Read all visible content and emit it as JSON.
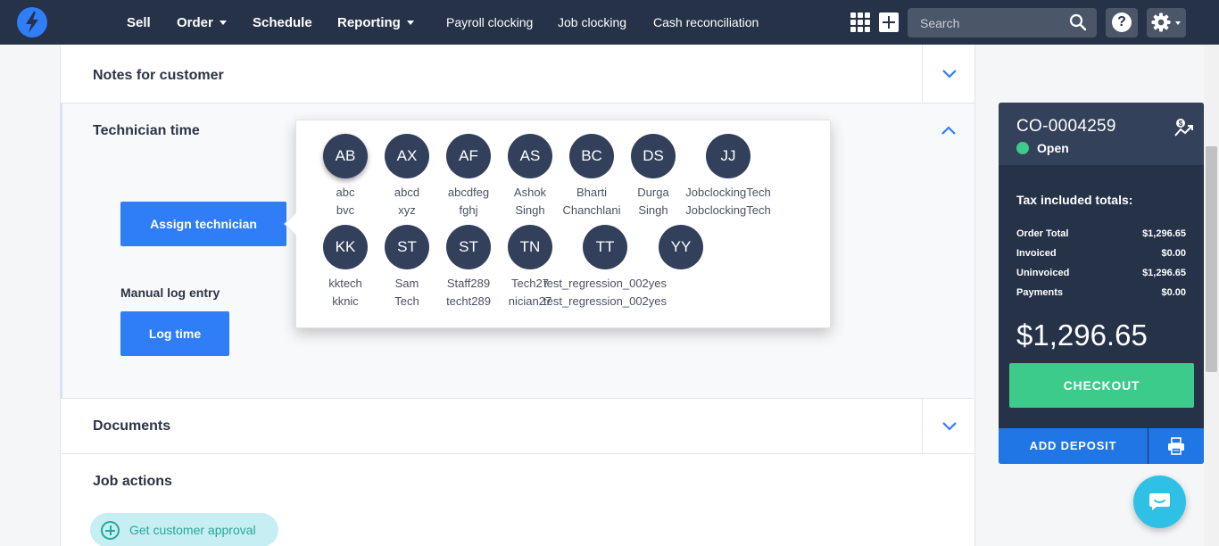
{
  "nav": {
    "items": [
      {
        "label": "Sell",
        "dropdown": false
      },
      {
        "label": "Order",
        "dropdown": true
      },
      {
        "label": "Schedule",
        "dropdown": false
      },
      {
        "label": "Reporting",
        "dropdown": true
      },
      {
        "label": "Payroll clocking"
      },
      {
        "label": "Job clocking"
      },
      {
        "label": "Cash reconciliation"
      }
    ],
    "search_placeholder": "Search",
    "help_label": "?"
  },
  "sections": {
    "notes_title": "Notes for customer",
    "tech_title": "Technician time",
    "assign_label": "Assign technician",
    "manual_label": "Manual log entry",
    "log_label": "Log time",
    "documents_title": "Documents",
    "job_actions_title": "Job actions",
    "approval_label": "Get customer approval"
  },
  "technicians": [
    {
      "initials": "AB",
      "line1": "abc",
      "line2": "bvc"
    },
    {
      "initials": "AX",
      "line1": "abcd",
      "line2": "xyz"
    },
    {
      "initials": "AF",
      "line1": "abcdfeg",
      "line2": "fghj"
    },
    {
      "initials": "AS",
      "line1": "Ashok",
      "line2": "Singh"
    },
    {
      "initials": "BC",
      "line1": "Bharti",
      "line2": "Chanchlani"
    },
    {
      "initials": "DS",
      "line1": "Durga",
      "line2": "Singh"
    },
    {
      "initials": "JJ",
      "line1": "JobclockingTech",
      "line2": "JobclockingTech"
    },
    {
      "initials": "KK",
      "line1": "kktech",
      "line2": "kknic"
    },
    {
      "initials": "ST",
      "line1": "Sam",
      "line2": "Tech"
    },
    {
      "initials": "ST",
      "line1": "Staff289",
      "line2": "techt289"
    },
    {
      "initials": "TN",
      "line1": "Tech27",
      "line2": "nician27"
    },
    {
      "initials": "TT",
      "line1": "test_regression_002yes",
      "line2": "test_regression_002yes"
    },
    {
      "initials": "YY",
      "line1": "",
      "line2": ""
    }
  ],
  "order": {
    "number": "CO-0004259",
    "status": "Open",
    "totals_title": "Tax included totals:",
    "rows": [
      {
        "label": "Order Total",
        "value": "$1,296.65"
      },
      {
        "label": "Invoiced",
        "value": "$0.00"
      },
      {
        "label": "Uninvoiced",
        "value": "$1,296.65"
      },
      {
        "label": "Payments",
        "value": "$0.00"
      }
    ],
    "grand_total": "$1,296.65",
    "checkout_label": "CHECKOUT",
    "deposit_label": "ADD DEPOSIT"
  },
  "colors": {
    "nav_bg": "#253248",
    "accent_blue": "#2f7ef7",
    "checkout_green": "#3ccb8b",
    "avatar_bg": "#32405c",
    "status_open": "#3ccb8b"
  }
}
